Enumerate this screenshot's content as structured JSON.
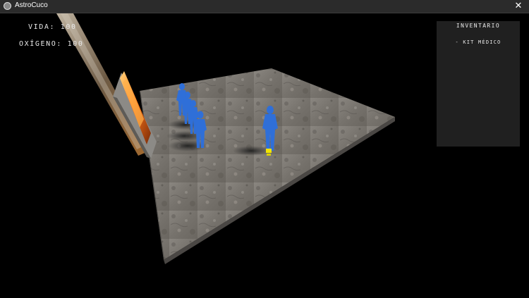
{
  "window": {
    "title": "AstroCuco",
    "close_glyph": "✕",
    "icon": "app-circle-icon"
  },
  "hud": {
    "vida_label": "Vida:",
    "vida_value": "100",
    "oxigeno_label": "Oxígeno:",
    "oxigeno_value": "100"
  },
  "inventory": {
    "title": "Inventario",
    "items": [
      "- Kit médico"
    ]
  },
  "colors": {
    "background": "#000000",
    "titlebar": "#2b2b2b",
    "characters": "#2f6fd8",
    "floor": "#7a7670",
    "portal_glow": "#ff7a1a",
    "inventory_panel": "#202020",
    "selection_marker": "#f2e600"
  }
}
